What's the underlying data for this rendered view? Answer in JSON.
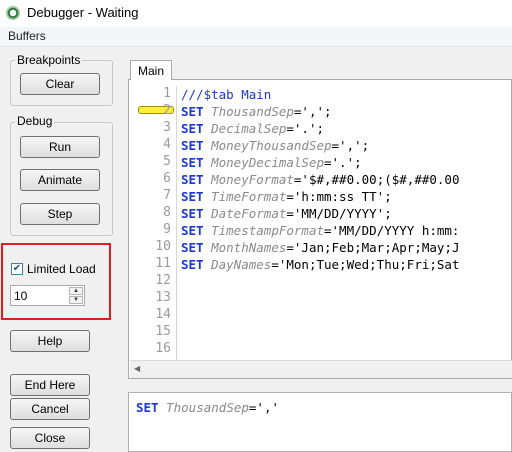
{
  "window": {
    "title": "Debugger - Waiting",
    "icon": "debugger-app-icon"
  },
  "menu": {
    "items": [
      "Buffers"
    ]
  },
  "breakpoints": {
    "label": "Breakpoints",
    "clear_label": "Clear"
  },
  "debug": {
    "label": "Debug",
    "run_label": "Run",
    "animate_label": "Animate",
    "step_label": "Step"
  },
  "limited_load": {
    "label": "Limited Load",
    "checked": true,
    "check_glyph": "✔",
    "value": "10",
    "highlight_color": "#e01e1e"
  },
  "buttons": {
    "help": "Help",
    "end_here": "End Here",
    "cancel": "Cancel",
    "close": "Close"
  },
  "tabs": [
    {
      "label": "Main",
      "active": true
    }
  ],
  "editor": {
    "current_line": 2,
    "line_numbers": [
      "1",
      "2",
      "3",
      "4",
      "5",
      "6",
      "7",
      "8",
      "9",
      "10",
      "11",
      "12",
      "13",
      "14",
      "15",
      "16"
    ],
    "lines": [
      {
        "parts": [
          {
            "text": "///$tab Main",
            "style": "cm"
          }
        ]
      },
      {
        "parts": [
          {
            "text": "SET ",
            "style": "kw"
          },
          {
            "text": "ThousandSep",
            "style": "var"
          },
          {
            "text": "=',';",
            "style": ""
          }
        ]
      },
      {
        "parts": [
          {
            "text": "SET ",
            "style": "kw"
          },
          {
            "text": "DecimalSep",
            "style": "var"
          },
          {
            "text": "='.';",
            "style": ""
          }
        ]
      },
      {
        "parts": [
          {
            "text": "SET ",
            "style": "kw"
          },
          {
            "text": "MoneyThousandSep",
            "style": "var"
          },
          {
            "text": "=',';",
            "style": ""
          }
        ]
      },
      {
        "parts": [
          {
            "text": "SET ",
            "style": "kw"
          },
          {
            "text": "MoneyDecimalSep",
            "style": "var"
          },
          {
            "text": "='.';",
            "style": ""
          }
        ]
      },
      {
        "parts": [
          {
            "text": "SET ",
            "style": "kw"
          },
          {
            "text": "MoneyFormat",
            "style": "var"
          },
          {
            "text": "='$#,##0.00;($#,##0.00",
            "style": ""
          }
        ]
      },
      {
        "parts": [
          {
            "text": "SET ",
            "style": "kw"
          },
          {
            "text": "TimeFormat",
            "style": "var"
          },
          {
            "text": "='h:mm:ss TT';",
            "style": ""
          }
        ]
      },
      {
        "parts": [
          {
            "text": "SET ",
            "style": "kw"
          },
          {
            "text": "DateFormat",
            "style": "var"
          },
          {
            "text": "='MM/DD/YYYY';",
            "style": ""
          }
        ]
      },
      {
        "parts": [
          {
            "text": "SET ",
            "style": "kw"
          },
          {
            "text": "TimestampFormat",
            "style": "var"
          },
          {
            "text": "='MM/DD/YYYY h:mm:",
            "style": ""
          }
        ]
      },
      {
        "parts": [
          {
            "text": "SET ",
            "style": "kw"
          },
          {
            "text": "MonthNames",
            "style": "var"
          },
          {
            "text": "='Jan;Feb;Mar;Apr;May;J",
            "style": ""
          }
        ]
      },
      {
        "parts": [
          {
            "text": "SET ",
            "style": "kw"
          },
          {
            "text": "DayNames",
            "style": "var"
          },
          {
            "text": "='Mon;Tue;Wed;Thu;Fri;Sat",
            "style": ""
          }
        ]
      }
    ]
  },
  "status": {
    "parts": [
      {
        "text": "SET ",
        "style": "kw"
      },
      {
        "text": "ThousandSep",
        "style": "var"
      },
      {
        "text": "=','",
        "style": ""
      }
    ]
  }
}
